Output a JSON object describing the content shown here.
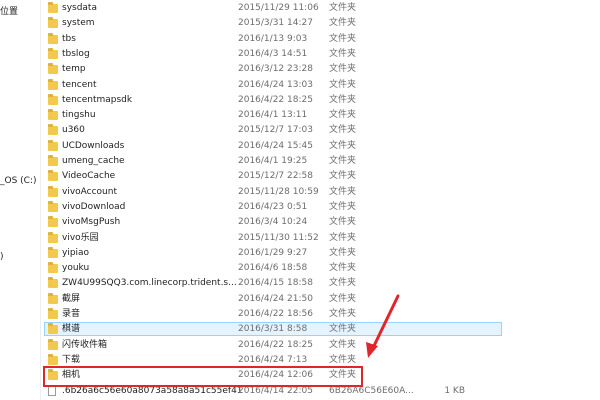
{
  "nav": {
    "items": [
      {
        "label": "位置"
      },
      {
        "label": "_OS (C:)"
      },
      {
        "label": ")"
      }
    ]
  },
  "files": [
    {
      "name": "sysdata",
      "date": "2015/11/29 11:06",
      "type": "文件夹",
      "size": "",
      "kind": "folder"
    },
    {
      "name": "system",
      "date": "2015/3/31 14:27",
      "type": "文件夹",
      "size": "",
      "kind": "folder"
    },
    {
      "name": "tbs",
      "date": "2016/1/13 9:03",
      "type": "文件夹",
      "size": "",
      "kind": "folder"
    },
    {
      "name": "tbslog",
      "date": "2016/4/3 14:51",
      "type": "文件夹",
      "size": "",
      "kind": "folder"
    },
    {
      "name": "temp",
      "date": "2016/3/12 23:28",
      "type": "文件夹",
      "size": "",
      "kind": "folder"
    },
    {
      "name": "tencent",
      "date": "2016/4/24 13:03",
      "type": "文件夹",
      "size": "",
      "kind": "folder"
    },
    {
      "name": "tencentmapsdk",
      "date": "2016/4/22 18:25",
      "type": "文件夹",
      "size": "",
      "kind": "folder"
    },
    {
      "name": "tingshu",
      "date": "2016/4/1 13:11",
      "type": "文件夹",
      "size": "",
      "kind": "folder"
    },
    {
      "name": "u360",
      "date": "2015/12/7 17:03",
      "type": "文件夹",
      "size": "",
      "kind": "folder"
    },
    {
      "name": "UCDownloads",
      "date": "2016/4/24 15:45",
      "type": "文件夹",
      "size": "",
      "kind": "folder"
    },
    {
      "name": "umeng_cache",
      "date": "2016/4/1 19:25",
      "type": "文件夹",
      "size": "",
      "kind": "folder"
    },
    {
      "name": "VideoCache",
      "date": "2015/12/7 22:58",
      "type": "文件夹",
      "size": "",
      "kind": "folder"
    },
    {
      "name": "vivoAccount",
      "date": "2015/11/28 10:59",
      "type": "文件夹",
      "size": "",
      "kind": "folder"
    },
    {
      "name": "vivoDownload",
      "date": "2016/4/23 0:51",
      "type": "文件夹",
      "size": "",
      "kind": "folder"
    },
    {
      "name": "vivoMsgPush",
      "date": "2016/3/4 10:24",
      "type": "文件夹",
      "size": "",
      "kind": "folder"
    },
    {
      "name": "vivo乐园",
      "date": "2015/11/30 11:52",
      "type": "文件夹",
      "size": "",
      "kind": "folder"
    },
    {
      "name": "yipiao",
      "date": "2016/1/29 9:27",
      "type": "文件夹",
      "size": "",
      "kind": "folder"
    },
    {
      "name": "youku",
      "date": "2016/4/6 18:58",
      "type": "文件夹",
      "size": "",
      "kind": "folder"
    },
    {
      "name": "ZW4U99SQQ3.com.linecorp.trident.s...",
      "date": "2016/4/15 18:58",
      "type": "文件夹",
      "size": "",
      "kind": "folder"
    },
    {
      "name": "截屏",
      "date": "2016/4/24 21:50",
      "type": "文件夹",
      "size": "",
      "kind": "folder"
    },
    {
      "name": "录音",
      "date": "2016/4/22 18:56",
      "type": "文件夹",
      "size": "",
      "kind": "folder"
    },
    {
      "name": "棋谱",
      "date": "2016/3/31 8:58",
      "type": "文件夹",
      "size": "",
      "kind": "folder",
      "selected": true
    },
    {
      "name": "闪传收件箱",
      "date": "2016/4/22 18:25",
      "type": "文件夹",
      "size": "",
      "kind": "folder"
    },
    {
      "name": "下载",
      "date": "2016/4/24 7:13",
      "type": "文件夹",
      "size": "",
      "kind": "folder"
    },
    {
      "name": "相机",
      "date": "2016/4/24 12:06",
      "type": "文件夹",
      "size": "",
      "kind": "folder",
      "highlighted": true
    },
    {
      "name": ".6b26a6c56e60a8073a58a8a51c55ef41",
      "date": "2016/4/14 22:05",
      "type": "6B26A6C56E60A...",
      "size": "1 KB",
      "kind": "file"
    }
  ],
  "colors": {
    "folder": "#f2c94c",
    "selection": "#e5f3ff",
    "annotation": "#e0262d"
  }
}
